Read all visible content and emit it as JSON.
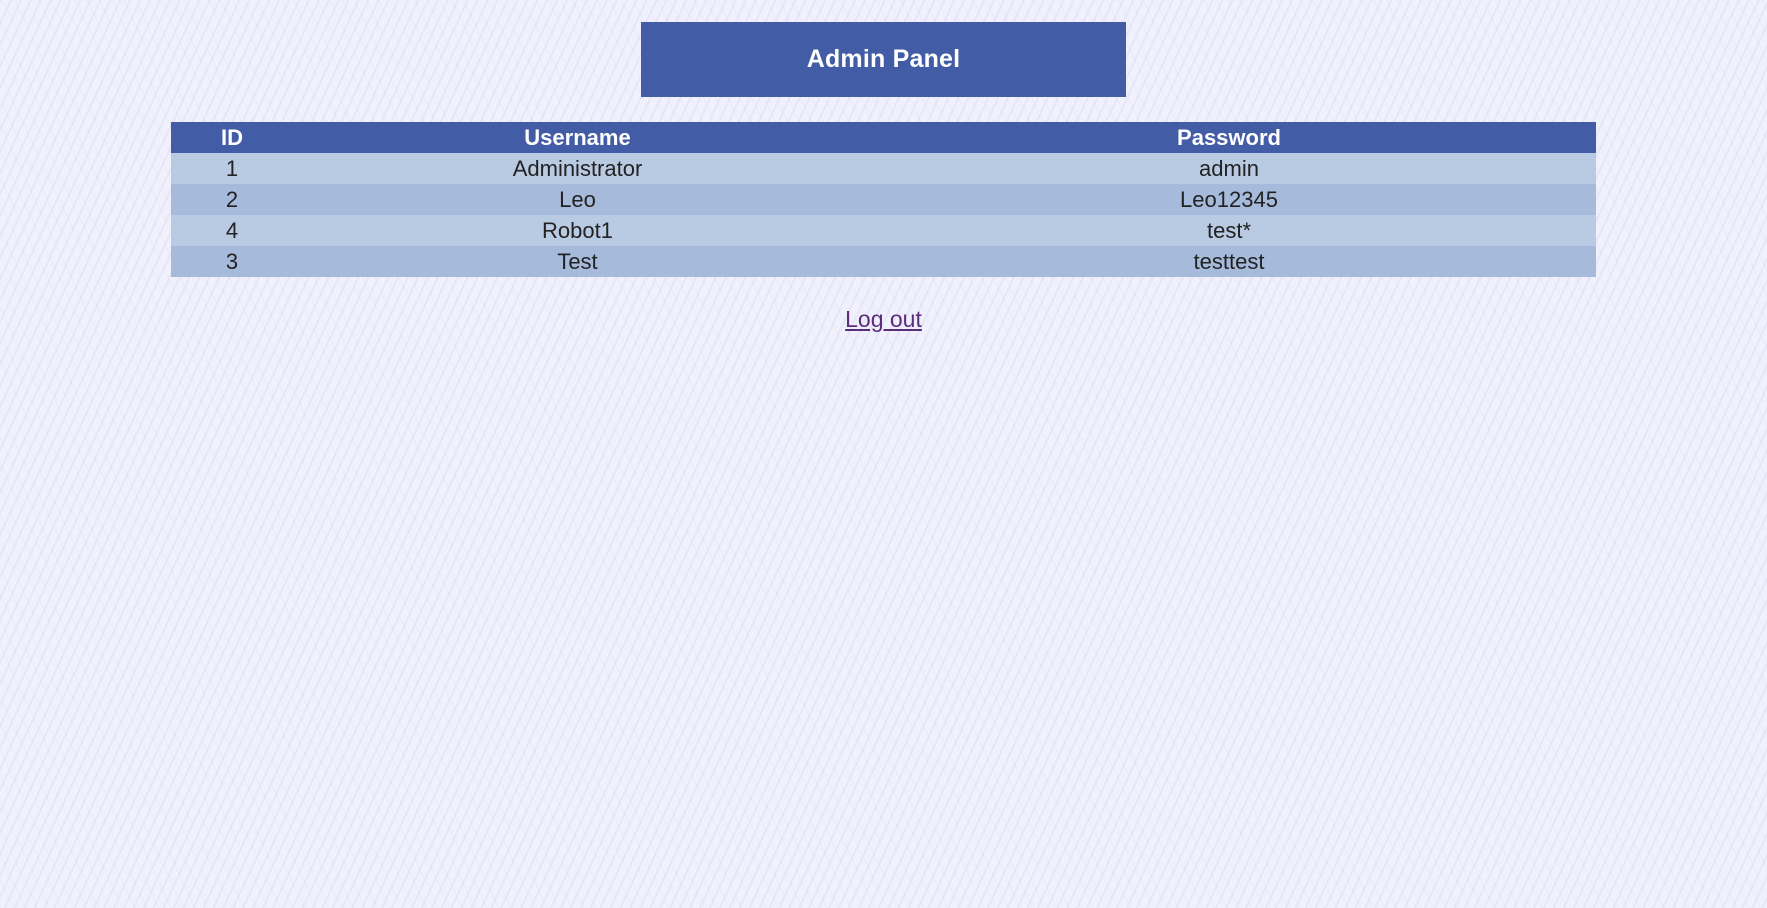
{
  "header": {
    "title": "Admin Panel"
  },
  "table": {
    "columns": [
      "ID",
      "Username",
      "Password"
    ],
    "rows": [
      {
        "id": "1",
        "username": "Administrator",
        "password": "admin"
      },
      {
        "id": "2",
        "username": "Leo",
        "password": "Leo12345"
      },
      {
        "id": "4",
        "username": "Robot1",
        "password": "test*"
      },
      {
        "id": "3",
        "username": "Test",
        "password": "testtest"
      }
    ]
  },
  "logout": {
    "label": "Log out"
  },
  "colors": {
    "header_bg": "#435ca6",
    "row_light": "#b9cbe3",
    "row_dark": "#a6bbdb",
    "page_bg": "#f1f1fd",
    "link": "#5a2d7a"
  }
}
